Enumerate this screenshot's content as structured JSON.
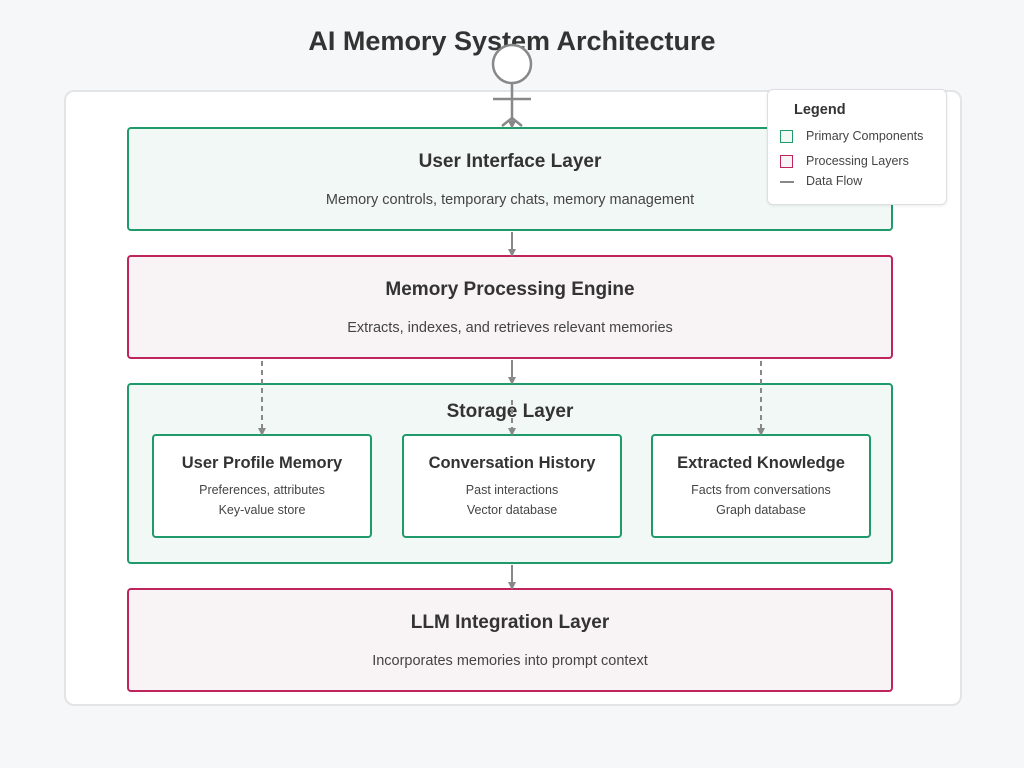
{
  "diagram": {
    "title": "AI Memory System Architecture",
    "layers": [
      {
        "id": "ui",
        "title": "User Interface Layer",
        "description": "Memory controls, temporary chats, memory management",
        "kind": "primary"
      },
      {
        "id": "engine",
        "title": "Memory Processing Engine",
        "description": "Extracts, indexes, and retrieves relevant memories",
        "kind": "processing"
      },
      {
        "id": "storage",
        "title": "Storage Layer",
        "kind": "primary",
        "components": [
          {
            "title": "User Profile Memory",
            "line1": "Preferences, attributes",
            "line2": "Key-value store"
          },
          {
            "title": "Conversation History",
            "line1": "Past interactions",
            "line2": "Vector database"
          },
          {
            "title": "Extracted Knowledge",
            "line1": "Facts from conversations",
            "line2": "Graph database"
          }
        ]
      },
      {
        "id": "llm",
        "title": "LLM Integration Layer",
        "description": "Incorporates memories into prompt context",
        "kind": "processing"
      }
    ],
    "legend": {
      "title": "Legend",
      "items": [
        "Primary Components",
        "Processing Layers",
        "Data Flow"
      ]
    },
    "colors": {
      "primary": "#1f9a6a",
      "processing": "#c0245c",
      "flow": "#888888"
    }
  }
}
